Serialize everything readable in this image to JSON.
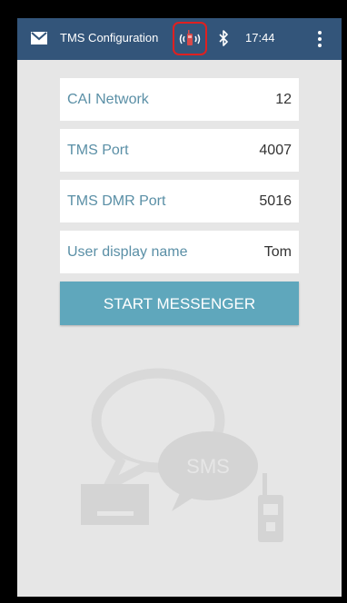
{
  "status_bar": {
    "title": "TMS Configuration",
    "time": "17:44",
    "icons": [
      "mail-icon",
      "radio-icon",
      "bluetooth-icon",
      "overflow-menu-icon"
    ]
  },
  "settings": [
    {
      "label": "CAI Network",
      "value": "12"
    },
    {
      "label": "TMS Port",
      "value": "4007"
    },
    {
      "label": "TMS DMR Port",
      "value": "5016"
    },
    {
      "label": "User display name",
      "value": "Tom"
    }
  ],
  "start_button": {
    "label": "START MESSENGER"
  },
  "watermark": {
    "text": "SMS"
  },
  "colors": {
    "app_bar": "#33557a",
    "accent": "#5fa7bc",
    "label": "#5a8fa6",
    "highlight": "#e02020"
  }
}
